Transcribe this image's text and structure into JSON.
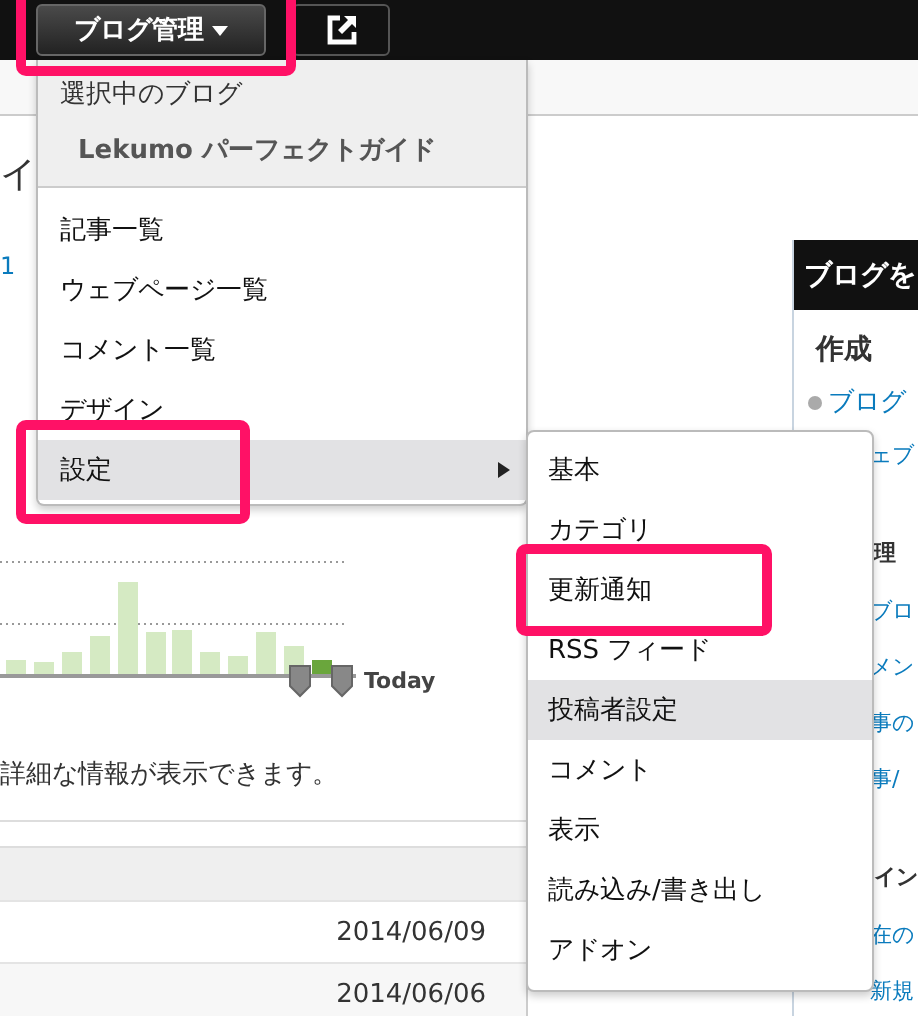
{
  "top_bar": {
    "blog_menu_button": "ブログ管理"
  },
  "page": {
    "title_fragment": "イ",
    "link_fragment": "1",
    "chart": {
      "today_label": "Today"
    },
    "note": "詳細な情報が表示できます。",
    "rows": [
      {
        "date": "2014/06/09"
      },
      {
        "date": "2014/06/06"
      }
    ]
  },
  "sidebar": {
    "title": "ブログを",
    "sections": [
      {
        "heading": "作成",
        "links": [
          "ブログ",
          "ェブ"
        ]
      },
      {
        "heading": "理",
        "links": [
          "ブロ",
          "メン",
          "事の",
          "事/"
        ]
      },
      {
        "heading": "イン",
        "links": [
          "在の",
          "新規"
        ]
      }
    ]
  },
  "menu": {
    "header": "選択中のブログ",
    "blog_name": "Lekumo パーフェクトガイド",
    "items": [
      {
        "label": "記事一覧",
        "selected": false,
        "has_submenu": false
      },
      {
        "label": "ウェブページ一覧",
        "selected": false,
        "has_submenu": false
      },
      {
        "label": "コメント一覧",
        "selected": false,
        "has_submenu": false
      },
      {
        "label": "デザイン",
        "selected": false,
        "has_submenu": false
      },
      {
        "label": "設定",
        "selected": true,
        "has_submenu": true
      }
    ]
  },
  "submenu": {
    "items": [
      {
        "label": "基本",
        "selected": false
      },
      {
        "label": "カテゴリ",
        "selected": false
      },
      {
        "label": "更新通知",
        "selected": false
      },
      {
        "label": "RSS フィード",
        "selected": false
      },
      {
        "label": "投稿者設定",
        "selected": true
      },
      {
        "label": "コメント",
        "selected": false
      },
      {
        "label": "表示",
        "selected": false
      },
      {
        "label": "読み込み/書き出し",
        "selected": false
      },
      {
        "label": "アドオン",
        "selected": false
      }
    ]
  }
}
